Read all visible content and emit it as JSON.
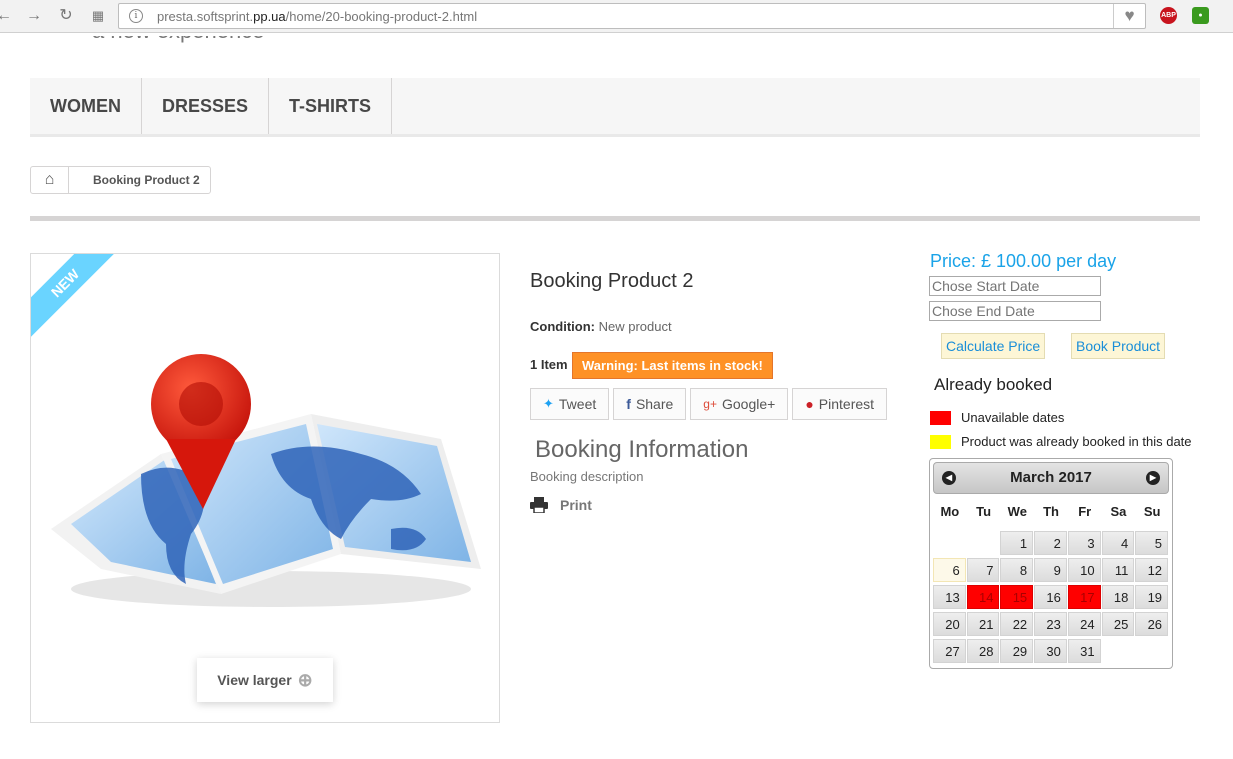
{
  "browser": {
    "url_prefix": "presta.softsprint.",
    "url_domain": "pp.ua",
    "url_path": "/home/20-booking-product-2.html",
    "ext_abp": "ABP"
  },
  "header": {
    "tagline": "a new experience"
  },
  "menu": {
    "items": [
      "WOMEN",
      "DRESSES",
      "T-SHIRTS"
    ]
  },
  "breadcrumb": {
    "current": "Booking Product 2"
  },
  "image": {
    "badge": "NEW",
    "view_larger": "View larger"
  },
  "product": {
    "name": "Booking Product 2",
    "condition_label": "Condition:",
    "condition_value": "New product",
    "quantity": "1 Item",
    "stock_warning": "Warning: Last items in stock!",
    "social": {
      "tweet": "Tweet",
      "share": "Share",
      "google": "Google+",
      "pinterest": "Pinterest"
    },
    "booking_title": "Booking Information",
    "booking_desc": "Booking description",
    "print": "Print"
  },
  "booking": {
    "price": "Price: £ 100.00 per day",
    "start_placeholder": "Chose Start Date",
    "end_placeholder": "Chose End Date",
    "calc_button": "Calculate Price",
    "book_button": "Book Product",
    "already_booked": "Already booked",
    "legend": [
      {
        "label": "Unavailable dates",
        "color": "#ff0000"
      },
      {
        "label": "Product was already booked in this date",
        "color": "#ffff00"
      }
    ]
  },
  "calendar": {
    "month": "March 2017",
    "weekdays": [
      "Mo",
      "Tu",
      "We",
      "Th",
      "Fr",
      "Sa",
      "Su"
    ],
    "weeks": [
      [
        "",
        "",
        "1",
        "2",
        "3",
        "4",
        "5"
      ],
      [
        "6",
        "7",
        "8",
        "9",
        "10",
        "11",
        "12"
      ],
      [
        "13",
        "14",
        "15",
        "16",
        "17",
        "18",
        "19"
      ],
      [
        "20",
        "21",
        "22",
        "23",
        "24",
        "25",
        "26"
      ],
      [
        "27",
        "28",
        "29",
        "30",
        "31",
        "",
        ""
      ]
    ],
    "today": "6",
    "booked": [
      "14",
      "15",
      "17"
    ]
  }
}
